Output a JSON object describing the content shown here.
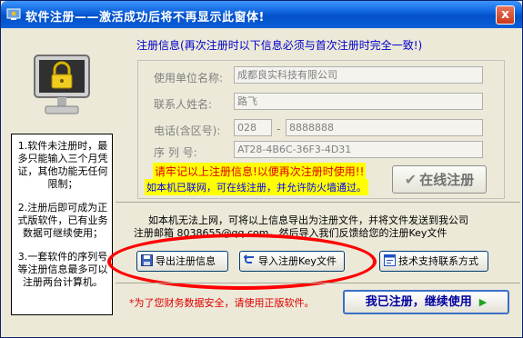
{
  "window": {
    "title": "软件注册——激活成功后将不再显示此窗体!",
    "close_label": "x"
  },
  "notes": {
    "p1": "1.软件未注册时，最多只能输入三个月凭证，其他功能无任何限制；",
    "p2": "2.注册后即可成为正式版软件，已有业务数据可继续使用；",
    "p3": "3.一套软件的序列号等注册信息最多可以注册两台计算机。"
  },
  "reg": {
    "heading": "注册信息",
    "heading_note": "(再次注册时以下信息必须与首次注册时完全一致!)",
    "fields": {
      "company_label": "使用单位名称:",
      "company_value": "成都良实科技有限公司",
      "contact_label": "联系人姓名:",
      "contact_value": "路飞",
      "phone_label": "电话(含区号):",
      "area_code": "028",
      "phone_sep": "-",
      "phone_value": "8888888",
      "serial_label": "序  列  号:",
      "serial_value": "AT28-4B6C-36F3-4D31"
    },
    "warn_keep": "请牢记以上注册信息!以便再次注册时使用!!",
    "warn_firewall": "如本机已联网，可在线注册，并允许防火墙通过。",
    "online_button": "在线注册"
  },
  "offline": {
    "info_line1": "如本机无法上网，可将以上信息导出为注册文件，并将文件发送到我公司",
    "info_line2": "注册邮箱 8038655@qq.com，然后导入我们反馈给您的注册Key文件",
    "export_button": "导出注册信息",
    "import_button": "导入注册Key文件",
    "support_button": "技术支持联系方式"
  },
  "footer": {
    "note": "*为了您财务数据安全，请使用正版软件。",
    "continue_button": "我已注册，继续使用"
  },
  "colors": {
    "titlebar": "#0a5fd9",
    "highlight": "#ffff00",
    "warning_red": "#e00000",
    "annotation_red": "#ff0000"
  }
}
